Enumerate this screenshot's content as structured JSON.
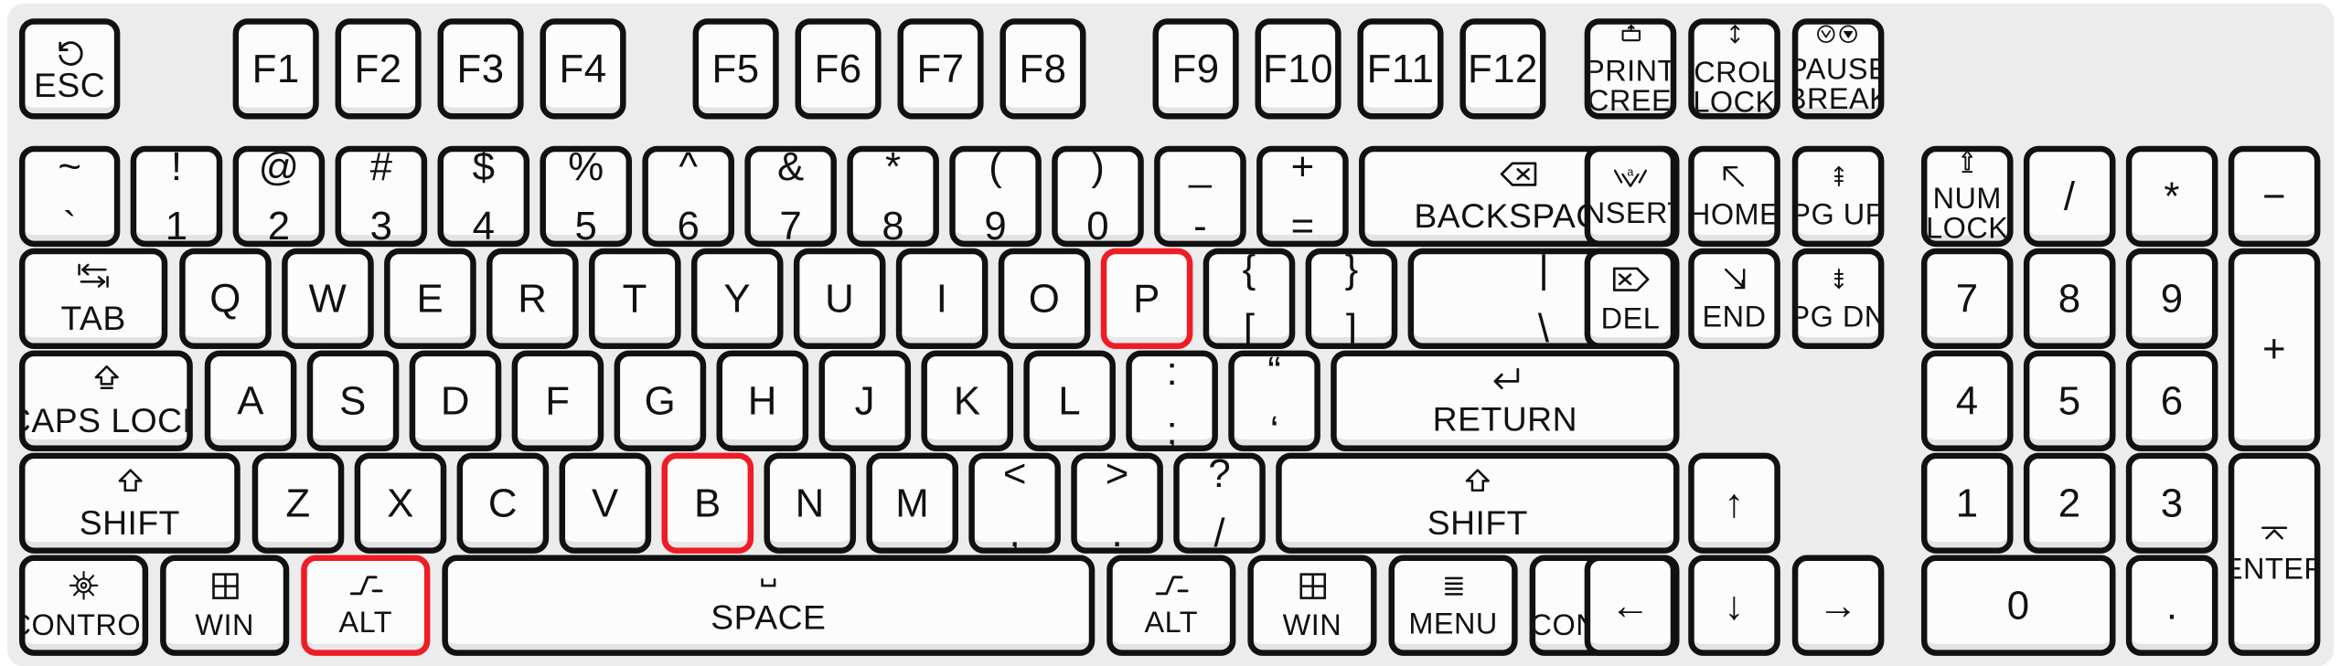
{
  "meta": {
    "title": "Full-size computer keyboard layout diagram",
    "background_color": "#ffffff",
    "body_color": "#ececec",
    "key_face_color": "#fcfcfc",
    "key_border_color": "#111111",
    "highlight_color": "#ee1c25",
    "highlighted_keys": [
      "P",
      "B",
      "ALT"
    ]
  },
  "keys": {
    "esc": {
      "label": "ESC",
      "icon": "rotate-ccw-icon"
    },
    "f1": {
      "label": "F1"
    },
    "f2": {
      "label": "F2"
    },
    "f3": {
      "label": "F3"
    },
    "f4": {
      "label": "F4"
    },
    "f5": {
      "label": "F5"
    },
    "f6": {
      "label": "F6"
    },
    "f7": {
      "label": "F7"
    },
    "f8": {
      "label": "F8"
    },
    "f9": {
      "label": "F9"
    },
    "f10": {
      "label": "F10"
    },
    "f11": {
      "label": "F11"
    },
    "f12": {
      "label": "F12"
    },
    "printscreen": {
      "line1": "PRINT",
      "line2": "SCREEN",
      "icon": "print-icon"
    },
    "scrolllock": {
      "line1": "SCROLL",
      "line2": "LOCK",
      "icon": "up-down-arrow-icon"
    },
    "pausebreak": {
      "line1": "PAUSE",
      "line2": "BREAK",
      "icon": "pause-break-icon"
    },
    "backtick": {
      "top": "~",
      "bottom": "`"
    },
    "one": {
      "top": "!",
      "bottom": "1"
    },
    "two": {
      "top": "@",
      "bottom": "2"
    },
    "three": {
      "top": "#",
      "bottom": "3"
    },
    "four": {
      "top": "$",
      "bottom": "4"
    },
    "five": {
      "top": "%",
      "bottom": "5"
    },
    "six": {
      "top": "^",
      "bottom": "6"
    },
    "seven": {
      "top": "&",
      "bottom": "7"
    },
    "eight": {
      "top": "*",
      "bottom": "8"
    },
    "nine": {
      "top": "(",
      "bottom": "9"
    },
    "zero": {
      "top": ")",
      "bottom": "0"
    },
    "minus": {
      "top": "_",
      "bottom": "-"
    },
    "equals": {
      "top": "+",
      "bottom": "="
    },
    "backspace": {
      "label": "BACKSPACE",
      "icon": "backspace-icon"
    },
    "insert": {
      "label": "INSERT",
      "icon": "insert-icon"
    },
    "home": {
      "label": "HOME",
      "icon": "arrow-up-left-icon"
    },
    "pgup": {
      "label": "PG UP",
      "icon": "page-up-icon"
    },
    "numlock": {
      "line1": "NUM",
      "line2": "LOCK",
      "icon": "lock-up-arrow-icon"
    },
    "npdivide": {
      "label": "/"
    },
    "npmultiply": {
      "label": "*"
    },
    "npminus": {
      "label": "−"
    },
    "tab": {
      "label": "TAB",
      "icon": "tab-icon"
    },
    "q": {
      "label": "Q"
    },
    "w": {
      "label": "W"
    },
    "e": {
      "label": "E"
    },
    "r": {
      "label": "R"
    },
    "t": {
      "label": "T"
    },
    "y": {
      "label": "Y"
    },
    "u": {
      "label": "U"
    },
    "i": {
      "label": "I"
    },
    "o": {
      "label": "O"
    },
    "p": {
      "label": "P",
      "highlighted": true
    },
    "lbracket": {
      "top": "{",
      "bottom": "["
    },
    "rbracket": {
      "top": "}",
      "bottom": "]"
    },
    "backslash": {
      "top": "|",
      "bottom": "\\"
    },
    "del": {
      "label": "DEL",
      "icon": "delete-icon"
    },
    "end": {
      "label": "END",
      "icon": "arrow-down-right-icon"
    },
    "pgdn": {
      "label": "PG DN",
      "icon": "page-down-icon"
    },
    "np7": {
      "label": "7"
    },
    "np8": {
      "label": "8"
    },
    "np9": {
      "label": "9"
    },
    "npplus": {
      "label": "+"
    },
    "capslock": {
      "label": "CAPS LOCK",
      "icon": "caps-lock-icon"
    },
    "a": {
      "label": "A"
    },
    "s": {
      "label": "S"
    },
    "d": {
      "label": "D"
    },
    "f": {
      "label": "F"
    },
    "g": {
      "label": "G"
    },
    "h": {
      "label": "H"
    },
    "j": {
      "label": "J"
    },
    "k": {
      "label": "K"
    },
    "l": {
      "label": "L"
    },
    "semicolon": {
      "top": ":",
      "bottom": ";"
    },
    "quote": {
      "top": "“",
      "bottom": "‘"
    },
    "return": {
      "label": "RETURN",
      "icon": "return-icon"
    },
    "np4": {
      "label": "4"
    },
    "np5": {
      "label": "5"
    },
    "np6": {
      "label": "6"
    },
    "lshift": {
      "label": "SHIFT",
      "icon": "shift-up-arrow-icon"
    },
    "z": {
      "label": "Z"
    },
    "x": {
      "label": "X"
    },
    "c": {
      "label": "C"
    },
    "v": {
      "label": "V"
    },
    "b": {
      "label": "B",
      "highlighted": true
    },
    "n": {
      "label": "N"
    },
    "m": {
      "label": "M"
    },
    "comma": {
      "top": "<",
      "bottom": ","
    },
    "period": {
      "top": ">",
      "bottom": "."
    },
    "slash": {
      "top": "?",
      "bottom": "/"
    },
    "rshift": {
      "label": "SHIFT",
      "icon": "shift-up-arrow-icon"
    },
    "arrowup": {
      "label": "↑"
    },
    "np1": {
      "label": "1"
    },
    "np2": {
      "label": "2"
    },
    "np3": {
      "label": "3"
    },
    "lcontrol": {
      "label": "CONTROL",
      "icon": "ships-wheel-icon"
    },
    "lwin": {
      "label": "WIN",
      "icon": "windows-icon"
    },
    "lalt": {
      "label": "ALT",
      "icon": "alt-step-icon",
      "highlighted": true
    },
    "space": {
      "label": "SPACE",
      "icon": "space-bracket-icon"
    },
    "ralt": {
      "label": "ALT",
      "icon": "alt-step-icon"
    },
    "rwin": {
      "label": "WIN",
      "icon": "windows-icon"
    },
    "menu": {
      "label": "MENU",
      "icon": "menu-lines-icon"
    },
    "rcontrol": {
      "label": "CONTROL",
      "icon": "ships-wheel-icon"
    },
    "arrowleft": {
      "label": "←"
    },
    "arrowdown": {
      "label": "↓"
    },
    "arrowright": {
      "label": "→"
    },
    "np0": {
      "label": "0"
    },
    "npdot": {
      "label": "."
    },
    "npenter": {
      "label": "ENTER",
      "icon": "enter-caret-icon"
    }
  }
}
